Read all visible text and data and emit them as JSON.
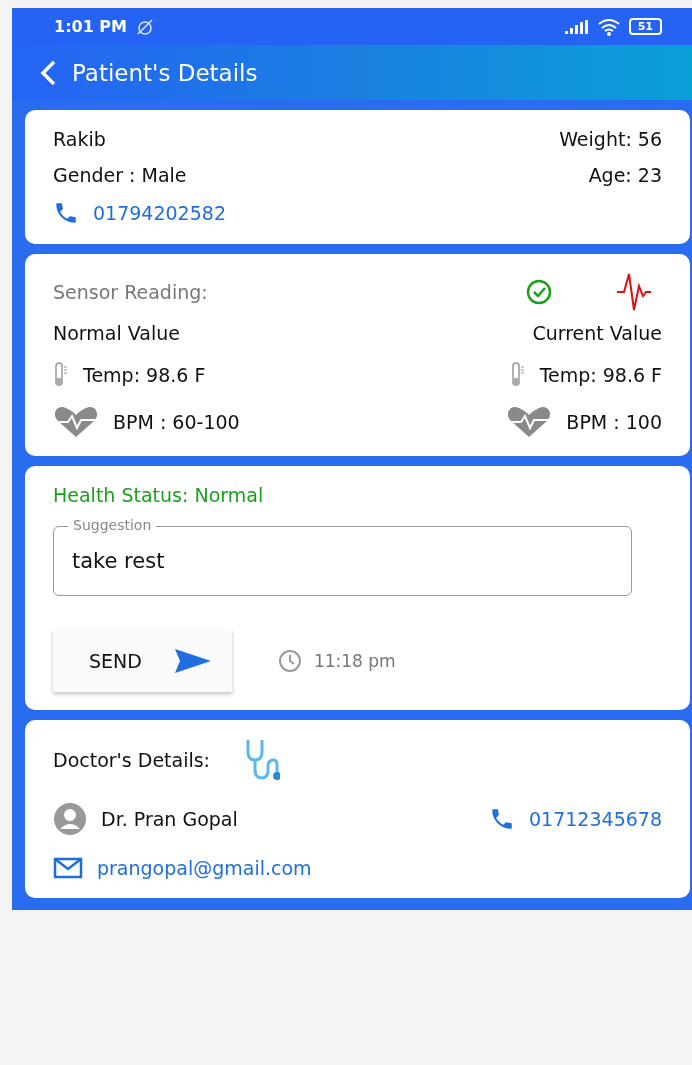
{
  "status_bar": {
    "time": "1:01 PM",
    "battery": "51"
  },
  "app_bar": {
    "title": "Patient's Details"
  },
  "patient": {
    "name": "Rakib",
    "weight": "Weight: 56",
    "gender": "Gender : Male",
    "age": "Age: 23",
    "phone": "01794202582"
  },
  "sensor": {
    "title": "Sensor Reading:",
    "normal_label": "Normal Value",
    "current_label": "Current Value",
    "normal": [
      {
        "kind": "temp",
        "text": "Temp: 98.6 F"
      },
      {
        "kind": "bpm",
        "text": "BPM : 60-100"
      }
    ],
    "current": [
      {
        "kind": "temp",
        "text": "Temp: 98.6 F"
      },
      {
        "kind": "bpm",
        "text": "BPM : 100"
      }
    ]
  },
  "health": {
    "status": "Health Status: Normal",
    "suggestion_label": "Suggestion",
    "suggestion": "take rest",
    "send": "SEND",
    "time": "11:18 pm"
  },
  "doctor": {
    "title": "Doctor's Details:",
    "name": "Dr. Pran Gopal",
    "phone": "01712345678",
    "email": "prangopal@gmail.com"
  }
}
